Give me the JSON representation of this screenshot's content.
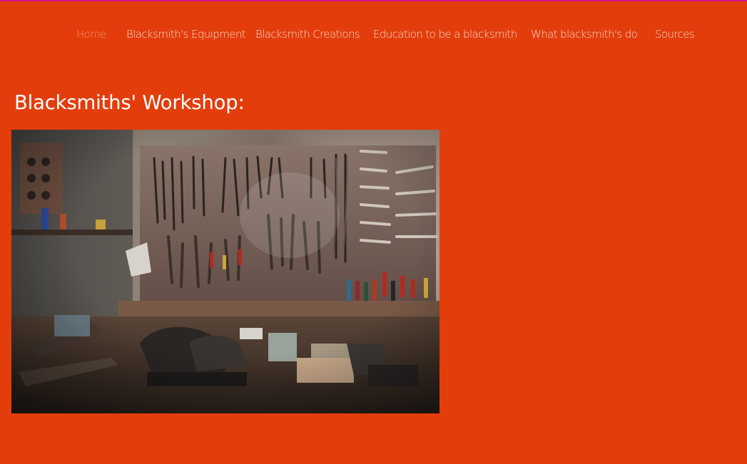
{
  "site": {
    "accent_color": "#e33d0c",
    "top_strip_color": "#d8128a"
  },
  "nav": {
    "items": [
      {
        "label": "Home",
        "active": true
      },
      {
        "label": "Blacksmith's Equipment"
      },
      {
        "label": "Blacksmith Creations"
      },
      {
        "label": "Education to be a blacksmith"
      },
      {
        "label": "What blacksmith's do"
      },
      {
        "label": "Sources"
      }
    ]
  },
  "main": {
    "title": "Blacksmiths' Workshop:",
    "image": {
      "watermark": "Stocksy"
    }
  }
}
